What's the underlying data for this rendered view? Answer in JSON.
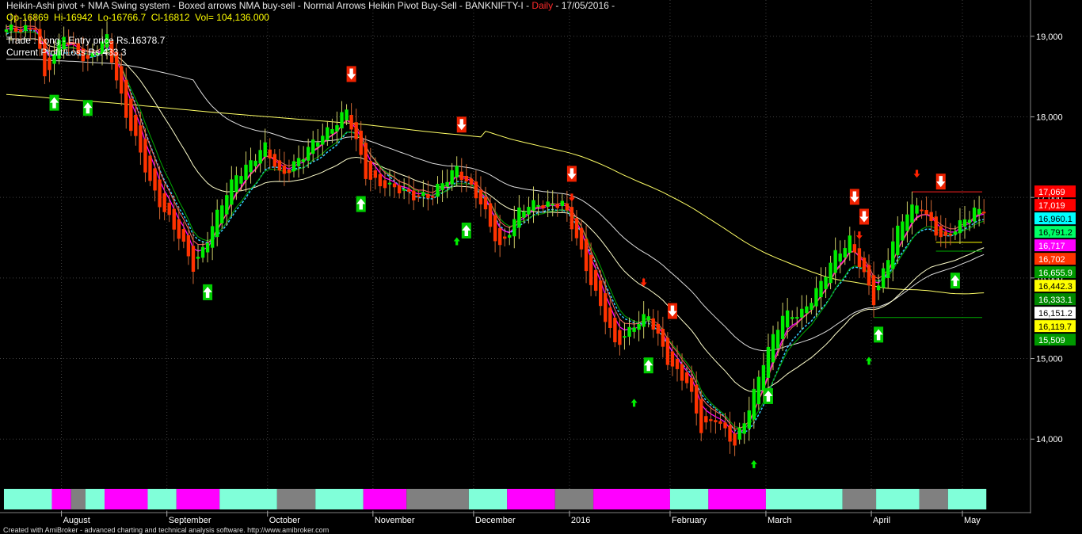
{
  "header": {
    "title_main": "Heikin-Ashi pivot + NMA Swing system - Boxed arrows NMA buy-sell - Normal Arrows Heikin Pivot Buy-Sell - BANKNIFTY-I - ",
    "title_interval": "Daily",
    "title_date": " - 17/05/2016 - ",
    "ohlc": "Op-16869  Hi-16942  Lo-16766.7  Cl-16812  Vol= 104,136.000",
    "trade": "Trade : Long - Entry price Rs.16378.7",
    "profit_loss": "Current Profit/Loss Rs.433.3"
  },
  "footer": "Created with AmiBroker - advanced charting and technical analysis software. http://www.amibroker.com",
  "colors": {
    "background": "#000000",
    "up_candle": "#00ee00",
    "down_candle": "#ff3300",
    "grid": "#404040",
    "magenta": "#ff00ff",
    "cyan": "#33ccff",
    "white": "#ffffff",
    "yellow": "#ffff66",
    "band_cyan": "#80ffd9",
    "band_gray": "#808080",
    "band_magenta": "#ff00ff"
  },
  "chart_data": {
    "type": "candlestick",
    "symbol": "BANKNIFTY-I",
    "interval": "Daily",
    "ylim": [
      13550,
      19450
    ],
    "y_ticks": [
      14000,
      15000,
      16000,
      17000,
      18000,
      19000
    ],
    "y_tick_labels": [
      "14,000",
      "15,000",
      "16,000",
      "17,000",
      "18,000",
      "19,000"
    ],
    "month_labels": [
      {
        "label": "August",
        "bar": 12
      },
      {
        "label": "September",
        "bar": 34
      },
      {
        "label": "October",
        "bar": 55
      },
      {
        "label": "November",
        "bar": 77
      },
      {
        "label": "December",
        "bar": 98
      },
      {
        "label": "2016",
        "bar": 118
      },
      {
        "label": "February",
        "bar": 139
      },
      {
        "label": "March",
        "bar": 159
      },
      {
        "label": "April",
        "bar": 181
      },
      {
        "label": "May",
        "bar": 200
      }
    ],
    "anchors": [
      [
        0,
        19050
      ],
      [
        6,
        19150
      ],
      [
        8,
        18450
      ],
      [
        12,
        19050
      ],
      [
        17,
        18650
      ],
      [
        21,
        19000
      ],
      [
        25,
        18000
      ],
      [
        30,
        17200
      ],
      [
        35,
        16600
      ],
      [
        39,
        16150
      ],
      [
        42,
        16500
      ],
      [
        48,
        17300
      ],
      [
        54,
        17600
      ],
      [
        57,
        17300
      ],
      [
        62,
        17500
      ],
      [
        66,
        17800
      ],
      [
        71,
        18050
      ],
      [
        75,
        17300
      ],
      [
        80,
        17100
      ],
      [
        85,
        17050
      ],
      [
        89,
        17000
      ],
      [
        94,
        17400
      ],
      [
        99,
        16900
      ],
      [
        103,
        16400
      ],
      [
        107,
        16800
      ],
      [
        111,
        16950
      ],
      [
        116,
        16900
      ],
      [
        119,
        16500
      ],
      [
        123,
        15800
      ],
      [
        127,
        15150
      ],
      [
        131,
        15450
      ],
      [
        134,
        15500
      ],
      [
        138,
        15000
      ],
      [
        142,
        14700
      ],
      [
        145,
        14100
      ],
      [
        148,
        14300
      ],
      [
        152,
        13900
      ],
      [
        154,
        14200
      ],
      [
        158,
        15000
      ],
      [
        162,
        15500
      ],
      [
        166,
        15600
      ],
      [
        170,
        15900
      ],
      [
        173,
        16300
      ],
      [
        176,
        16500
      ],
      [
        179,
        16000
      ],
      [
        181,
        15700
      ],
      [
        185,
        16500
      ],
      [
        188,
        16800
      ],
      [
        191,
        16900
      ],
      [
        194,
        16600
      ],
      [
        196,
        16450
      ],
      [
        199,
        16650
      ],
      [
        202,
        16880
      ],
      [
        204,
        16812
      ]
    ],
    "horizontal_levels": [
      {
        "label": "17,069",
        "value": 17069,
        "bg": "#ff0000",
        "fg": "#ffffff",
        "line": false
      },
      {
        "label": "17,019",
        "value": 17019,
        "bg": "#ff0000",
        "fg": "#ffffff",
        "line": false
      },
      {
        "label": "16,960.1",
        "value": 16960.1,
        "bg": "#00ffff",
        "fg": "#000000",
        "line": false
      },
      {
        "label": "16,791.2",
        "value": 16791.2,
        "bg": "#00ff66",
        "fg": "#000000",
        "line": false
      },
      {
        "label": "16,717",
        "value": 16717,
        "bg": "#ff00ff",
        "fg": "#ffffff",
        "line": false
      },
      {
        "label": "16,702",
        "value": 16702,
        "bg": "#ff3300",
        "fg": "#ffffff",
        "line": false
      },
      {
        "label": "16,655.9",
        "value": 16655.9,
        "bg": "#009900",
        "fg": "#ffffff",
        "line": false
      },
      {
        "label": "16,442.3",
        "value": 16442.3,
        "bg": "#ffff00",
        "fg": "#000000",
        "line": false
      },
      {
        "label": "16,333.1",
        "value": 16333.1,
        "bg": "#008800",
        "fg": "#ffffff",
        "line": false
      },
      {
        "label": "16,151.2",
        "value": 16151.2,
        "bg": "#ffffff",
        "fg": "#000000",
        "line": false
      },
      {
        "label": "16,119.7",
        "value": 16119.7,
        "bg": "#ffff00",
        "fg": "#000000",
        "line": false
      },
      {
        "label": "15,509",
        "value": 15509,
        "bg": "#009900",
        "fg": "#ffffff",
        "line": true
      }
    ],
    "boxed_buy_bars": [
      10,
      17,
      42,
      74,
      96,
      134,
      159,
      182,
      198
    ],
    "boxed_sell_bars": [
      20,
      72,
      95,
      118,
      139,
      177,
      179,
      195
    ],
    "plain_buy_bars": [
      94,
      131,
      156,
      180
    ],
    "plain_sell_bars": [
      118,
      133,
      178,
      190
    ],
    "state_band": [
      {
        "from": 0,
        "to": 9,
        "state": "cyan"
      },
      {
        "from": 10,
        "to": 13,
        "state": "magenta"
      },
      {
        "from": 14,
        "to": 16,
        "state": "gray"
      },
      {
        "from": 17,
        "to": 20,
        "state": "cyan"
      },
      {
        "from": 21,
        "to": 29,
        "state": "magenta"
      },
      {
        "from": 30,
        "to": 35,
        "state": "cyan"
      },
      {
        "from": 36,
        "to": 44,
        "state": "magenta"
      },
      {
        "from": 45,
        "to": 56,
        "state": "cyan"
      },
      {
        "from": 57,
        "to": 64,
        "state": "gray"
      },
      {
        "from": 65,
        "to": 74,
        "state": "cyan"
      },
      {
        "from": 75,
        "to": 83,
        "state": "magenta"
      },
      {
        "from": 84,
        "to": 96,
        "state": "gray"
      },
      {
        "from": 97,
        "to": 104,
        "state": "cyan"
      },
      {
        "from": 105,
        "to": 114,
        "state": "magenta"
      },
      {
        "from": 115,
        "to": 122,
        "state": "gray"
      },
      {
        "from": 123,
        "to": 138,
        "state": "magenta"
      },
      {
        "from": 139,
        "to": 146,
        "state": "cyan"
      },
      {
        "from": 147,
        "to": 158,
        "state": "magenta"
      },
      {
        "from": 159,
        "to": 174,
        "state": "cyan"
      },
      {
        "from": 175,
        "to": 181,
        "state": "gray"
      },
      {
        "from": 182,
        "to": 190,
        "state": "cyan"
      },
      {
        "from": 191,
        "to": 196,
        "state": "gray"
      },
      {
        "from": 197,
        "to": 204,
        "state": "cyan"
      }
    ]
  }
}
